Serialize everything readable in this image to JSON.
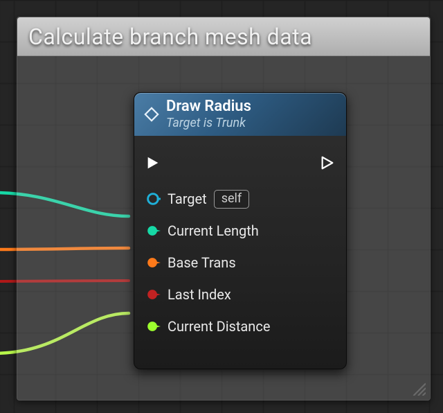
{
  "comment": {
    "title": "Calculate branch mesh data"
  },
  "node": {
    "title": "Draw Radius",
    "subtitle": "Target is Trunk",
    "header_color": "#3d6f9a",
    "pins": {
      "exec_in": {
        "icon": "exec-in-icon"
      },
      "exec_out": {
        "icon": "exec-out-icon"
      },
      "target": {
        "label": "Target",
        "value": "self",
        "color": "#1fb0d8"
      },
      "length": {
        "label": "Current Length",
        "color": "#16d9a6"
      },
      "trans": {
        "label": "Base Trans",
        "color": "#ff7a1a"
      },
      "last": {
        "label": "Last Index",
        "color": "#c22222"
      },
      "dist": {
        "label": "Current Distance",
        "color": "#9dff2e"
      }
    }
  },
  "wires": [
    {
      "name": "current-length-wire",
      "color": "#16d9a6"
    },
    {
      "name": "base-trans-wire",
      "color": "#ff7a1a"
    },
    {
      "name": "last-index-wire",
      "color": "#b01818"
    },
    {
      "name": "current-distance-wire",
      "color": "#b8f74a"
    }
  ]
}
